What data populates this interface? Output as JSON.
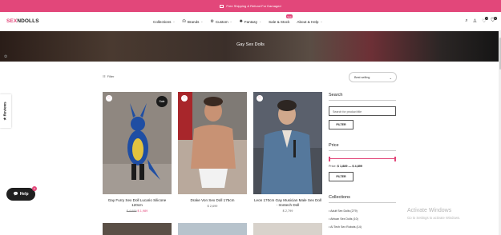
{
  "announcement": {
    "text": "Free Shipping & Refund For Damaged"
  },
  "header": {
    "logo_part1": "SEX",
    "logo_part2": "NDOLLS",
    "nav": [
      {
        "label": "Collections",
        "icon": ""
      },
      {
        "label": "Brands",
        "icon": "headset-icon"
      },
      {
        "label": "Custom",
        "icon": "gear-icon"
      },
      {
        "label": "Fantasy",
        "icon": "sparkle-icon"
      },
      {
        "label": "Sale & Stock",
        "icon": "",
        "badge": "Sale"
      },
      {
        "label": "About & Help",
        "icon": ""
      }
    ],
    "icons": [
      "search-icon",
      "user-icon",
      "heart-icon",
      "cart-icon"
    ],
    "wishlist_count": "0",
    "cart_count": "0"
  },
  "hero": {
    "title": "Gay Sex Dolls"
  },
  "reviews_tab": "Reviews",
  "toolbar": {
    "filter_label": "Filter",
    "sort_label": "Best selling"
  },
  "products": [
    {
      "name": "Gay Furry Sex Doll Lucario Silicone 120cm",
      "old_price": "$ 4,699",
      "price": "$ 1,989",
      "badge": "Sale",
      "colors": [
        "#8f8780",
        "#1f4ea3"
      ]
    },
    {
      "name": "Drake Von Sex Doll 175cm",
      "old_price": "",
      "price": "$ 2,699",
      "badge": "",
      "colors": [
        "#c89274",
        "#b9a99c"
      ]
    },
    {
      "name": "Leon 170cm Gay Musician Male Sex Doll - Irontech Doll",
      "old_price": "",
      "price": "$ 2,799",
      "badge": "",
      "colors": [
        "#5a606c",
        "#55789c"
      ]
    }
  ],
  "sidebar": {
    "search_title": "Search",
    "search_placeholder": "Search for product title",
    "filter_button": "FILTER",
    "price_title": "Price",
    "price_prefix": "Price:",
    "price_range": "$ 1,889 — $ 4,899",
    "collections_title": "Collections",
    "collections": [
      "Adult Sex Dolls (279)",
      "African Sex Dolls (10)",
      "AI Tech Sex Robots (14)"
    ]
  },
  "watermark": {
    "line1": "Activate Windows",
    "line2": "Go to Settings to activate Windows."
  },
  "help_widget": {
    "label": "Help",
    "count": "1"
  },
  "colors": {
    "accent": "#e2477a",
    "dark": "#1a1a1a"
  }
}
